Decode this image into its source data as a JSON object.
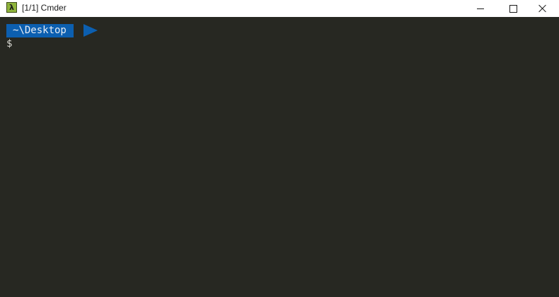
{
  "window": {
    "title": "[1/1] Cmder",
    "icon": "lambda-icon",
    "icon_glyph": "λ",
    "controls": {
      "minimize": "minimize-icon",
      "maximize": "maximize-icon",
      "close": "close-icon"
    }
  },
  "terminal": {
    "prompt_path": "~\\Desktop",
    "prompt_symbol": "$",
    "colors": {
      "background": "#272822",
      "prompt_segment": "#0c5fb0",
      "text": "#d8d8d2"
    }
  }
}
